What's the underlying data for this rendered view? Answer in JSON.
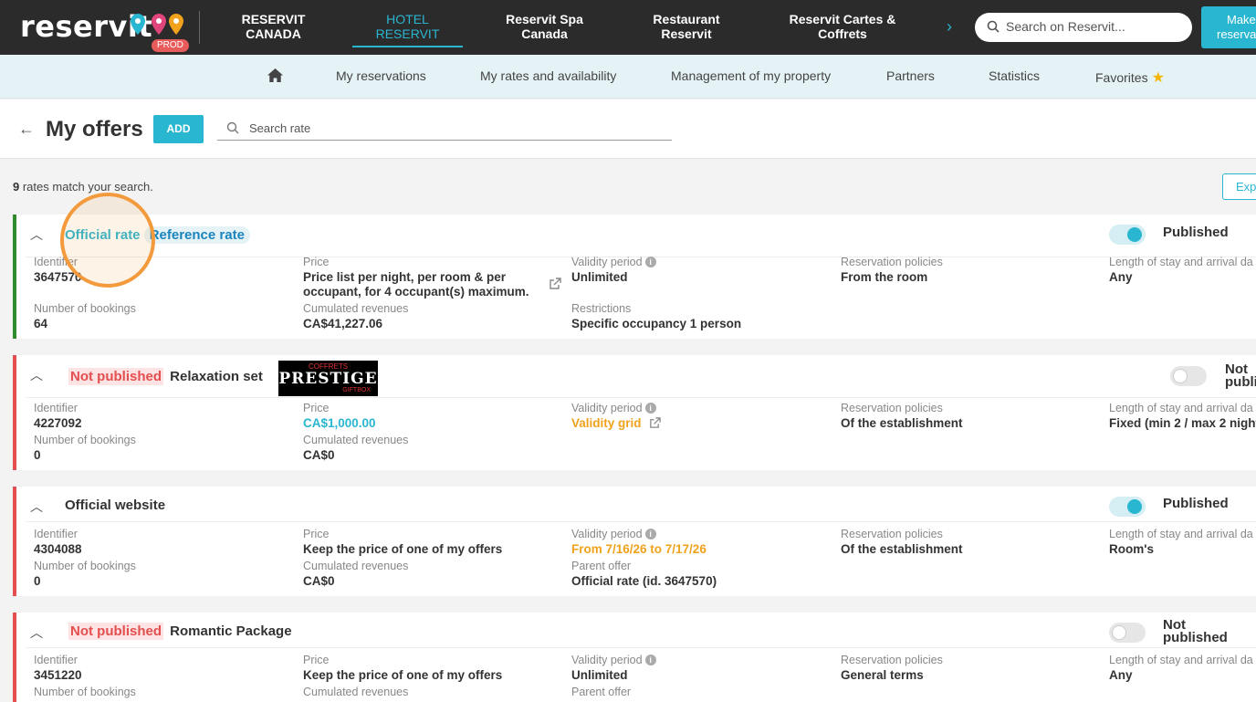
{
  "topbar": {
    "logo": "reservit",
    "env_badge": "PROD",
    "nav": [
      {
        "line1": "RESERVIT",
        "line2": "CANADA"
      },
      {
        "line1": "HOTEL",
        "line2": "RESERVIT"
      },
      {
        "line1": "Reservit Spa",
        "line2": "Canada"
      },
      {
        "line1": "Restaurant",
        "line2": "Reservit"
      },
      {
        "line1": "Reservit Cartes &",
        "line2": "Coffrets"
      }
    ],
    "search_placeholder": "Search on Reservit...",
    "make_button": {
      "line1": "Make",
      "line2": "reserva"
    }
  },
  "subnav": {
    "items": [
      "My reservations",
      "My rates and availability",
      "Management of my property",
      "Partners",
      "Statistics",
      "Favorites"
    ]
  },
  "header": {
    "title": "My offers",
    "add_label": "ADD",
    "search_placeholder": "Search rate"
  },
  "results": {
    "count": "9",
    "text": " rates match your search.",
    "expand_label": "Expa"
  },
  "labels": {
    "identifier": "Identifier",
    "bookings": "Number of bookings",
    "price": "Price",
    "revenues": "Cumulated revenues",
    "validity": "Validity period",
    "restrictions": "Restrictions",
    "parent": "Parent offer",
    "policies": "Reservation policies",
    "length": "Length of stay and arrival da"
  },
  "offers": [
    {
      "tag1": "Official rate",
      "tag2": "Reference rate",
      "name": "",
      "status": "Published",
      "identifier": "3647570",
      "bookings": "64",
      "price": "Price list per night, per room & per occupant, for 4 occupant(s) maximum.",
      "revenues": "CA$41,227.06",
      "validity": "Unlimited",
      "extra_label": "Restrictions",
      "extra_value": "Specific occupancy 1 person",
      "policies": "From the room",
      "length": "Any"
    },
    {
      "tag1": "Not published",
      "name": "Relaxation set",
      "status": "Not publi",
      "identifier": "4227092",
      "bookings": "0",
      "price": "CA$1,000.00",
      "revenues": "CA$0",
      "validity": "Validity grid",
      "policies": "Of the establishment",
      "length": "Fixed (min 2 / max 2 night",
      "giftbox": {
        "top": "COFFRETS",
        "brand": "PRESTIGE",
        "bottom": "GIFTBOX"
      }
    },
    {
      "name": "Official website",
      "status": "Published",
      "identifier": "4304088",
      "bookings": "0",
      "price": "Keep the price of one of my offers",
      "revenues": "CA$0",
      "validity": "From 7/16/26 to 7/17/26",
      "extra_label": "Parent offer",
      "extra_value": "Official rate (id. 3647570)",
      "policies": "Of the establishment",
      "length": "Room's"
    },
    {
      "tag1": "Not published",
      "name": "Romantic Package",
      "status": "Not published",
      "identifier": "3451220",
      "price": "Keep the price of one of my offers",
      "validity": "Unlimited",
      "extra_label": "Parent offer",
      "policies": "General terms",
      "length": "Any"
    }
  ],
  "colors": {
    "accent": "#29b6d1",
    "topbar": "#2b2b2b",
    "red": "#e34e4e",
    "green": "#2e8b2e",
    "orange": "#f0a21c"
  }
}
